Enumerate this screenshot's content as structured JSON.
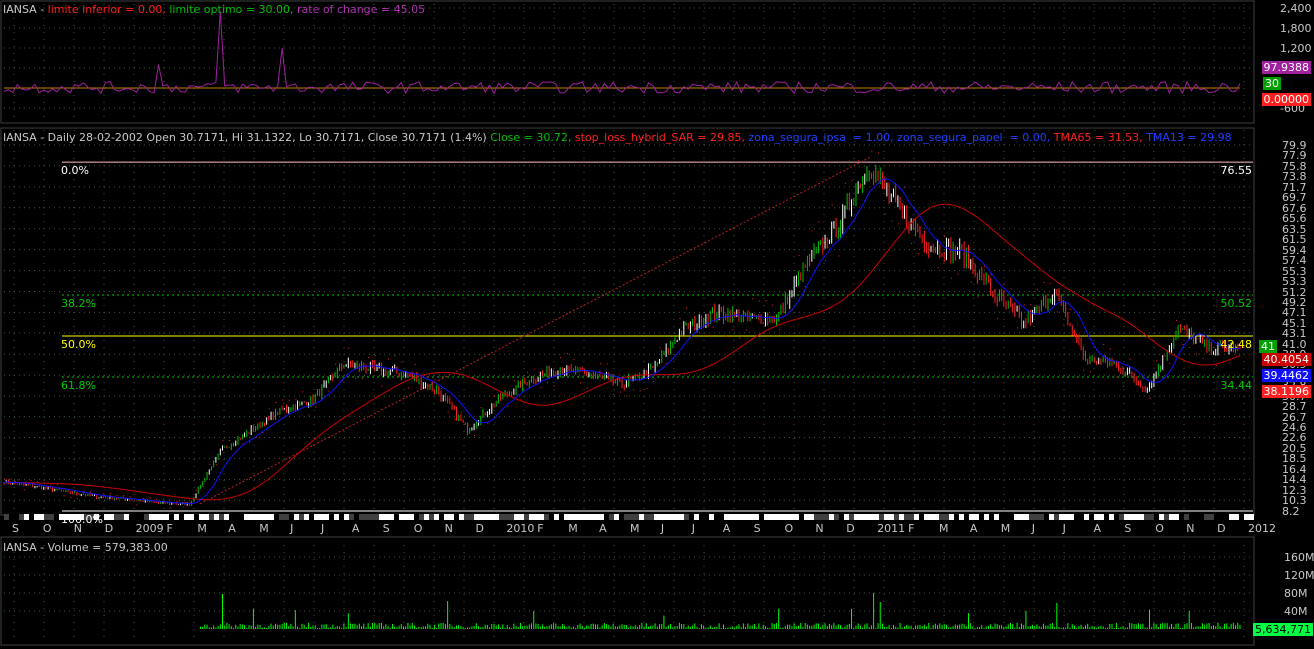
{
  "colors": {
    "background": "#000000",
    "bull": "#00c000",
    "bear": "#ff2020",
    "neutral": "#ffffff",
    "tma13": "#1010ff",
    "tma65": "#cc0000",
    "sar": "#ff2020",
    "roc": "#a020a0",
    "volume": "#00ff00",
    "fib_green": "#00cc00",
    "fib_yellow": "#ffff00",
    "fib_top": "#ffc0c0",
    "grid": "#3a5a3a"
  },
  "roc_panel": {
    "header": {
      "symbol": "IANSA - ",
      "lower_label": "limite inferior = 0.00, ",
      "optimum_label": "limite optimo = 30.00, ",
      "roc_label": "rate of change = 45.05"
    },
    "axis_ticks": [
      "2,400",
      "1,800",
      "1,200",
      "600",
      "-600"
    ],
    "tags": {
      "roc": "97.9388",
      "optimum": "30",
      "lower": "0.00000"
    }
  },
  "price_panel": {
    "header": {
      "base": "IANSA - Daily 28-02-2002 Open 30.7171, Hi 31.1322, Lo 30.7171, Close 30.7171 (1.4%) ",
      "close": "Close = 30.72, ",
      "sar": "stop_loss_hybrid_SAR = 29.85, ",
      "ipsa": "zona_segura_ipsa  = 1.00, ",
      "papel": "zona_segura_papel  = 0.00, ",
      "tma65": "TMA65 = 31.53, ",
      "tma13": "TMA13 = 29.98"
    },
    "axis_ticks": [
      "79.9",
      "77.9",
      "75.8",
      "73.8",
      "71.7",
      "69.7",
      "67.6",
      "65.6",
      "63.5",
      "61.5",
      "59.4",
      "57.4",
      "55.3",
      "53.3",
      "51.2",
      "49.2",
      "47.1",
      "45.1",
      "43.1",
      "41.0",
      "38.9",
      "36.9",
      "34.8",
      "32.8",
      "30.7",
      "28.7",
      "26.7",
      "24.6",
      "22.6",
      "20.5",
      "18.5",
      "16.4",
      "14.4",
      "12.3",
      "10.3",
      "8.2"
    ],
    "fib_left": [
      "0.0%",
      "38.2%",
      "50.0%",
      "61.8%",
      "100.0%"
    ],
    "fib_right": [
      "76.55",
      "50.52",
      "42.48",
      "34.44"
    ],
    "tags": {
      "volume_count": "41",
      "tma65": "40.4054",
      "tma13": "39.4462",
      "sar": "38.1196"
    },
    "month_labels": [
      "S",
      "O",
      "N",
      "D",
      "2009",
      "F",
      "M",
      "A",
      "M",
      "J",
      "J",
      "A",
      "S",
      "O",
      "N",
      "D",
      "2010",
      "F",
      "M",
      "A",
      "M",
      "J",
      "J",
      "A",
      "S",
      "O",
      "N",
      "D",
      "2011",
      "F",
      "M",
      "A",
      "M",
      "J",
      "J",
      "A",
      "S",
      "O",
      "N",
      "D",
      "2012"
    ]
  },
  "volume_panel": {
    "header": "IANSA - Volume = 579,383.00",
    "axis_ticks": [
      "160M",
      "120M",
      "80M",
      "40M"
    ],
    "tag": "5,634,771"
  },
  "chart_data": {
    "type": "candlestick",
    "title": "IANSA - Daily",
    "x_range": [
      "2008-09",
      "2012-01"
    ],
    "ylim": [
      8.2,
      79.9
    ],
    "price_path": [
      [
        "2008-09",
        14.0
      ],
      [
        "2008-10",
        13.0
      ],
      [
        "2008-11",
        12.0
      ],
      [
        "2008-12",
        11.0
      ],
      [
        "2009-01",
        10.5
      ],
      [
        "2009-02",
        9.8
      ],
      [
        "2009-03",
        9.5
      ],
      [
        "2009-04",
        20.0
      ],
      [
        "2009-05",
        24.0
      ],
      [
        "2009-06",
        28.0
      ],
      [
        "2009-07",
        30.0
      ],
      [
        "2009-08",
        37.0
      ],
      [
        "2009-09",
        36.0
      ],
      [
        "2009-10",
        35.0
      ],
      [
        "2009-11",
        32.0
      ],
      [
        "2009-12",
        24.0
      ],
      [
        "2010-01",
        30.0
      ],
      [
        "2010-02",
        34.0
      ],
      [
        "2010-03",
        36.0
      ],
      [
        "2010-04",
        35.0
      ],
      [
        "2010-05",
        33.0
      ],
      [
        "2010-06",
        36.0
      ],
      [
        "2010-07",
        44.0
      ],
      [
        "2010-08",
        47.0
      ],
      [
        "2010-09",
        46.0
      ],
      [
        "2010-10",
        46.0
      ],
      [
        "2010-11",
        57.0
      ],
      [
        "2010-12",
        64.0
      ],
      [
        "2011-01",
        76.0
      ],
      [
        "2011-02",
        67.0
      ],
      [
        "2011-03",
        60.0
      ],
      [
        "2011-04",
        59.0
      ],
      [
        "2011-05",
        51.0
      ],
      [
        "2011-06",
        45.0
      ],
      [
        "2011-07",
        51.0
      ],
      [
        "2011-08",
        38.0
      ],
      [
        "2011-09",
        37.0
      ],
      [
        "2011-10",
        32.0
      ],
      [
        "2011-11",
        44.0
      ],
      [
        "2011-12",
        40.0
      ],
      [
        "2012-01",
        40.0
      ]
    ],
    "fibonacci": [
      {
        "level": "0.0%",
        "value": 76.55
      },
      {
        "level": "38.2%",
        "value": 50.52
      },
      {
        "level": "50.0%",
        "value": 42.48
      },
      {
        "level": "61.8%",
        "value": 34.44
      },
      {
        "level": "100.0%",
        "value": 8.2
      }
    ],
    "last_values": {
      "tma65": 40.4054,
      "tma13": 39.4462,
      "sar": 38.1196,
      "roc": 97.9388
    },
    "volume_ylim": [
      0,
      180
    ],
    "volume_spikes_m": [
      [
        "2009-04",
        78
      ],
      [
        "2009-05",
        45
      ],
      [
        "2009-06",
        42
      ],
      [
        "2009-08",
        35
      ],
      [
        "2009-11",
        62
      ],
      [
        "2010-02",
        40
      ],
      [
        "2010-06",
        30
      ],
      [
        "2010-10",
        45
      ],
      [
        "2010-12",
        45
      ],
      [
        "2011-01",
        80
      ],
      [
        "2011-01",
        60
      ],
      [
        "2011-04",
        35
      ],
      [
        "2011-06",
        40
      ],
      [
        "2011-07",
        58
      ],
      [
        "2011-10",
        43
      ],
      [
        "2011-11",
        40
      ]
    ],
    "roc_ylim": [
      -900,
      2400
    ],
    "roc_spikes": [
      [
        "2009-04",
        2300
      ],
      [
        "2009-06",
        1200
      ],
      [
        "2009-02",
        700
      ]
    ]
  }
}
